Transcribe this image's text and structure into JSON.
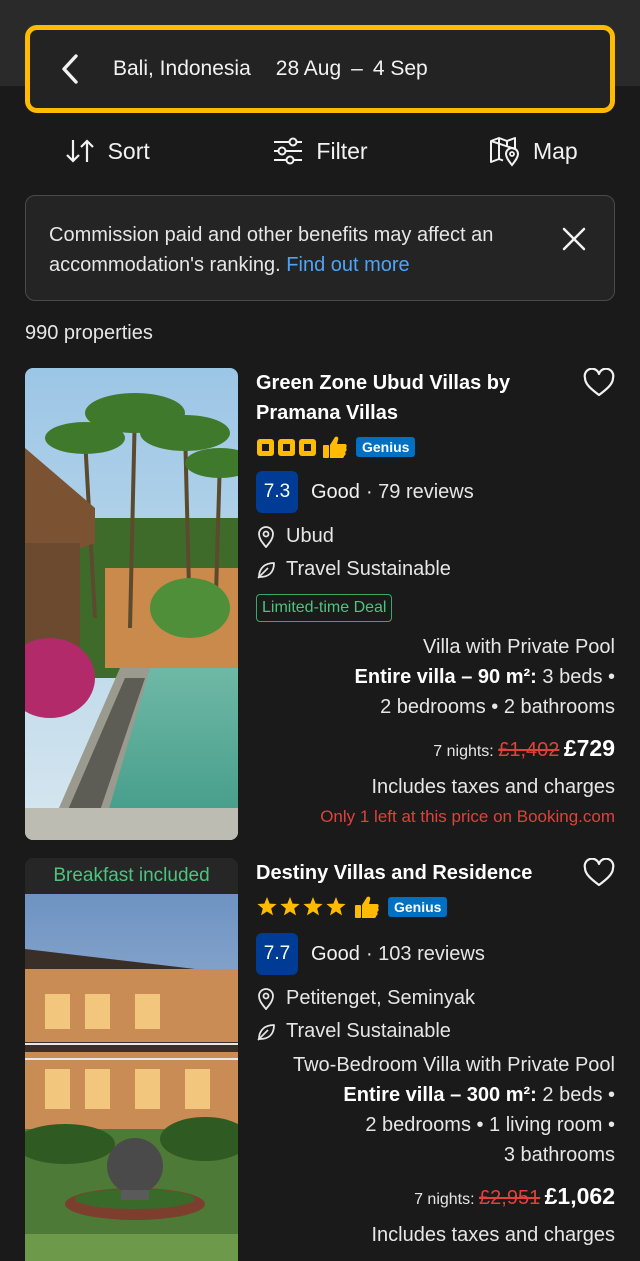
{
  "search": {
    "destination": "Bali, Indonesia",
    "check_in": "28 Aug",
    "separator": "–",
    "check_out": "4 Sep",
    "highlight_color": "#febb02"
  },
  "actions": {
    "sort": "Sort",
    "filter": "Filter",
    "map": "Map"
  },
  "notice": {
    "text": "Commission paid and other benefits may affect an accommodation's ranking.",
    "link": "Find out more"
  },
  "results": {
    "count": "990 properties"
  },
  "properties": [
    {
      "name": "Green Zone Ubud Villas by Pramana Villas",
      "star_style": "squares",
      "stars": 3,
      "genius": "Genius",
      "score": "7.3",
      "rating_word": "Good",
      "reviews": "· 79 reviews",
      "location": "Ubud",
      "sustainable": "Travel Sustainable",
      "deal": "Limited-time Deal",
      "room_type": "Villa with Private Pool",
      "room_bold": "Entire villa – 90 m²:",
      "room_details_1": "3 beds •",
      "room_details_2": "2 bedrooms • 2 bathrooms",
      "nights": "7 nights:",
      "old_price": "£1,402",
      "new_price": "£729",
      "taxes": "Includes taxes and charges",
      "scarcity": "Only 1 left at this price on Booking.com"
    },
    {
      "badge": "Breakfast included",
      "name": "Destiny Villas and Residence",
      "star_style": "stars",
      "stars": 4,
      "genius": "Genius",
      "score": "7.7",
      "rating_word": "Good",
      "reviews": "· 103 reviews",
      "location": "Petitenget, Seminyak",
      "sustainable": "Travel Sustainable",
      "room_type": "Two-Bedroom Villa with Private Pool",
      "room_bold": "Entire villa – 300 m²:",
      "room_details_1": "2 beds •",
      "room_details_2": "2 bedrooms • 1 living room •",
      "room_details_3": "3 bathrooms",
      "nights": "7 nights:",
      "old_price": "£2,951",
      "new_price": "£1,062",
      "taxes": "Includes taxes and charges"
    }
  ]
}
